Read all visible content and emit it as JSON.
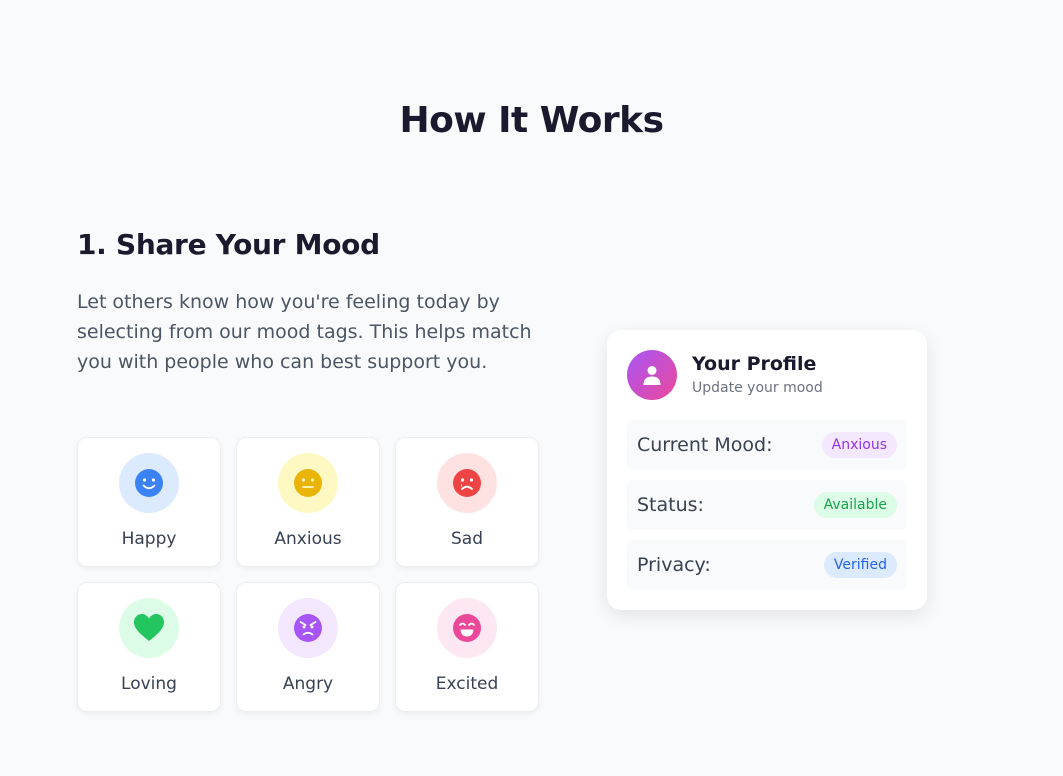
{
  "section": {
    "title": "How It Works"
  },
  "step": {
    "title": "1. Share Your Mood",
    "description": "Let others know how you're feeling today by selecting from our mood tags. This helps match you with people who can best support you."
  },
  "moods": [
    {
      "label": "Happy",
      "icon": "happy-face-icon",
      "color": "#3b82f6",
      "bg": "#dbeafe"
    },
    {
      "label": "Anxious",
      "icon": "neutral-face-icon",
      "color": "#eab308",
      "bg": "#fef9c3"
    },
    {
      "label": "Sad",
      "icon": "sad-face-icon",
      "color": "#ef4444",
      "bg": "#fee2e2"
    },
    {
      "label": "Loving",
      "icon": "heart-icon",
      "color": "#22c55e",
      "bg": "#dcfce7"
    },
    {
      "label": "Angry",
      "icon": "angry-face-icon",
      "color": "#a855f7",
      "bg": "#f3e8ff"
    },
    {
      "label": "Excited",
      "icon": "grin-face-icon",
      "color": "#ec4899",
      "bg": "#fce7f3"
    }
  ],
  "profile": {
    "name": "Your Profile",
    "subtitle": "Update your mood",
    "rows": [
      {
        "label": "Current Mood:",
        "value": "Anxious",
        "color": "#9333ea",
        "bg": "#f3e8ff"
      },
      {
        "label": "Status:",
        "value": "Available",
        "color": "#16a34a",
        "bg": "#dcfce7"
      },
      {
        "label": "Privacy:",
        "value": "Verified",
        "color": "#2563eb",
        "bg": "#dbeafe"
      }
    ]
  }
}
